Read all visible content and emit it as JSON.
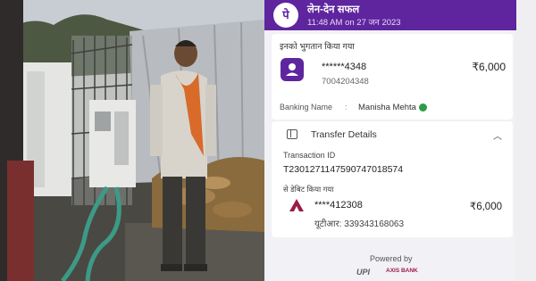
{
  "header": {
    "logo_text": "पे",
    "title": "लेन-देन सफल",
    "datetime": "11:48 AM on 27 जन 2023",
    "brand_color": "#5f259f"
  },
  "payee": {
    "section_label": "इनको भुगतान किया गया",
    "account_masked": "******4348",
    "phone": "7004204348",
    "amount": "₹6,000",
    "icon": "contact-avatar-icon"
  },
  "banking_name": {
    "label": "Banking Name",
    "separator": ":",
    "value": "Manisha  Mehta",
    "badge_icon": "verified-shield-icon"
  },
  "transfer_details": {
    "title": "Transfer Details",
    "expanded": true,
    "transaction_id_label": "Transaction ID",
    "transaction_id": "T2301271147590747018574",
    "debited_from_label": "से डेबिट किया गया",
    "debit_account_masked": "****412308",
    "debit_amount": "₹6,000",
    "utr": "यूटीआर: 339343168063",
    "bank_icon": "axis-bank-icon"
  },
  "footer": {
    "powered_by": "Powered by",
    "upi_logo_text": "UPI",
    "bank_logo_text": "AXIS BANK"
  },
  "photo": {
    "description_icon": "news-photo"
  }
}
